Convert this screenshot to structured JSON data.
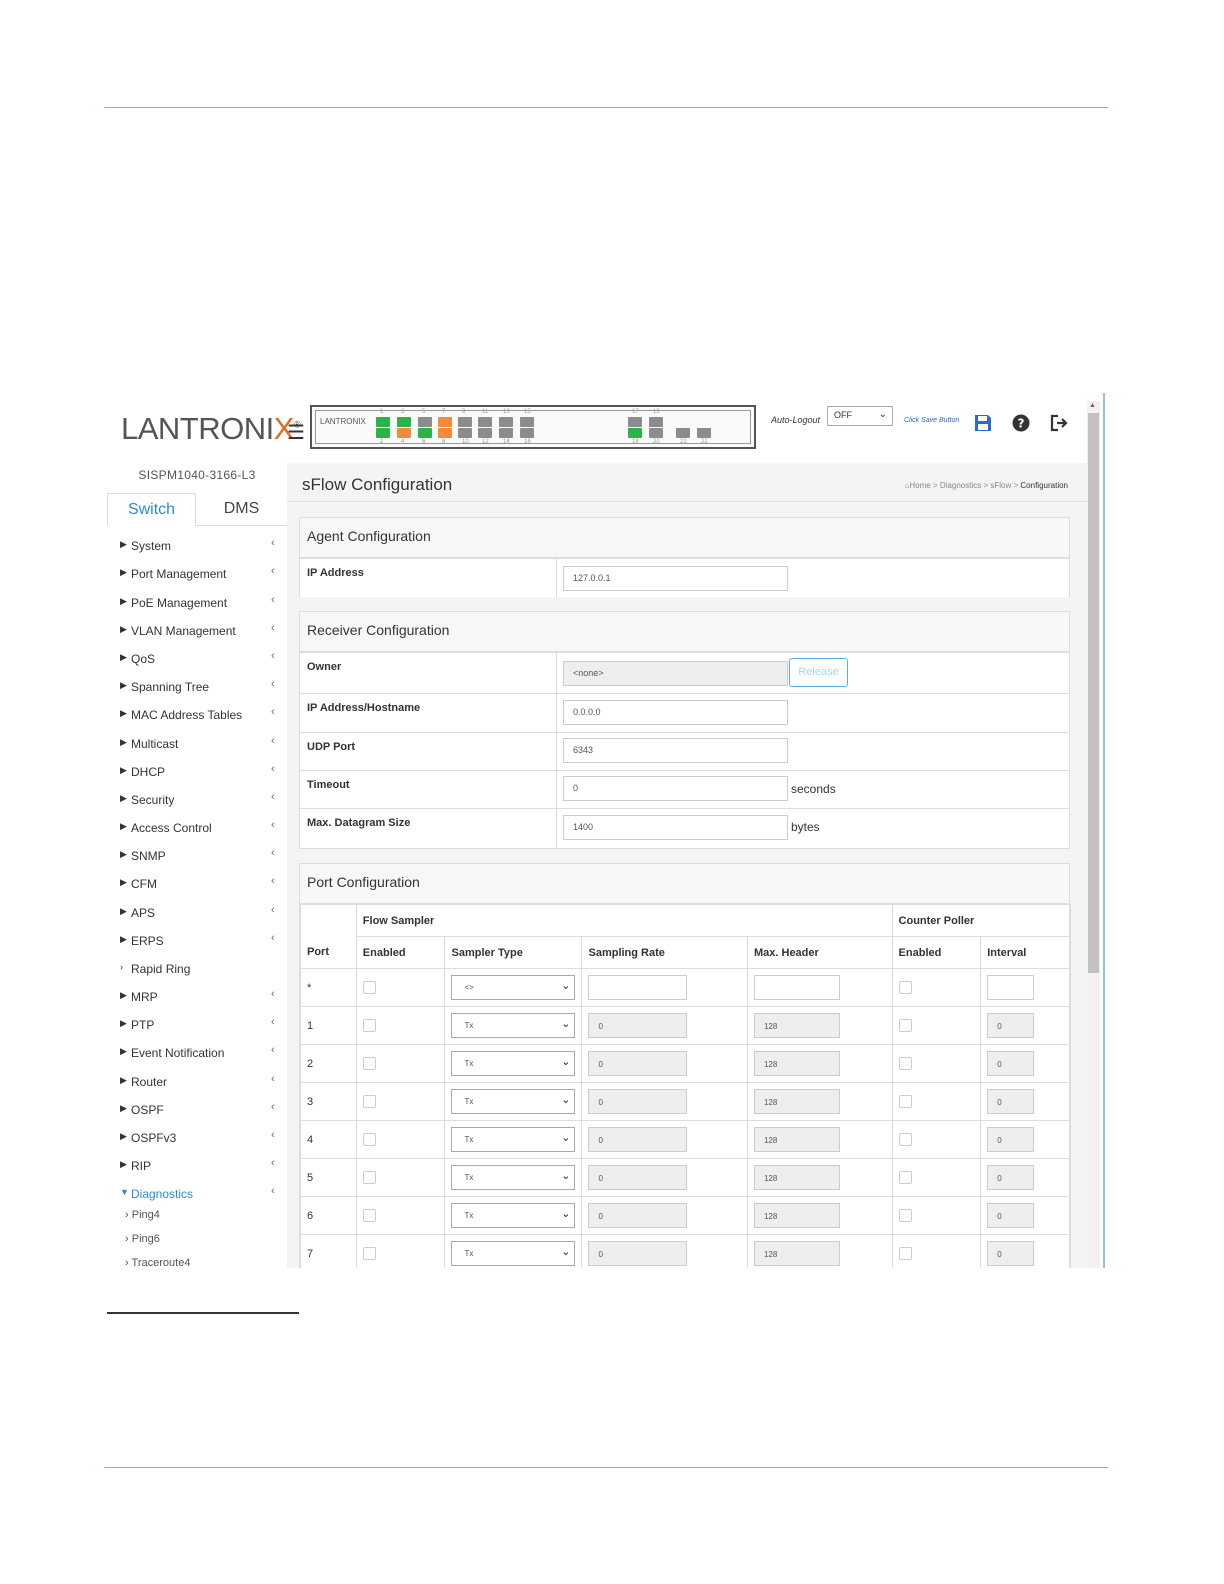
{
  "header": {
    "logo_text": "LANTRONIX",
    "panel_logo": "LANTRONIX",
    "auto_logout_label": "Auto-Logout",
    "auto_logout_value": "OFF",
    "save_hint": "Click Save Button",
    "port_numbers_top": [
      "1",
      "3",
      "5",
      "7",
      "9",
      "11",
      "13",
      "15",
      "17",
      "19"
    ],
    "port_numbers_bottom": [
      "2",
      "4",
      "6",
      "8",
      "10",
      "12",
      "14",
      "16",
      "18",
      "20",
      "21",
      "22"
    ]
  },
  "sidebar": {
    "device_name": "SISPM1040-3166-L3",
    "tabs": [
      "Switch",
      "DMS"
    ],
    "items": [
      "System",
      "Port Management",
      "PoE Management",
      "VLAN Management",
      "QoS",
      "Spanning Tree",
      "MAC Address Tables",
      "Multicast",
      "DHCP",
      "Security",
      "Access Control",
      "SNMP",
      "CFM",
      "APS",
      "ERPS",
      "Rapid Ring",
      "MRP",
      "PTP",
      "Event Notification",
      "Router",
      "OSPF",
      "OSPFv3",
      "RIP",
      "Diagnostics"
    ],
    "sub_items": [
      "Ping4",
      "Ping6",
      "Traceroute4"
    ]
  },
  "content": {
    "title": "sFlow Configuration",
    "breadcrumb": {
      "home": "Home",
      "sep": ">",
      "b1": "Diagnostics",
      "b2": "sFlow",
      "b3": "Configuration"
    },
    "agent": {
      "heading": "Agent Configuration",
      "ip_label": "IP Address",
      "ip_value": "127.0.0.1"
    },
    "receiver": {
      "heading": "Receiver Configuration",
      "owner_label": "Owner",
      "owner_value": "<none>",
      "release_label": "Release",
      "host_label": "IP Address/Hostname",
      "host_value": "0.0.0.0",
      "udp_label": "UDP Port",
      "udp_value": "6343",
      "timeout_label": "Timeout",
      "timeout_value": "0",
      "timeout_unit": "seconds",
      "dgram_label": "Max. Datagram Size",
      "dgram_value": "1400",
      "dgram_unit": "bytes"
    },
    "ports": {
      "heading": "Port Configuration",
      "group_flow": "Flow Sampler",
      "group_counter": "Counter Poller",
      "col_port": "Port",
      "col_enabled": "Enabled",
      "col_type": "Sampler Type",
      "col_rate": "Sampling Rate",
      "col_header": "Max. Header",
      "col_c_enabled": "Enabled",
      "col_interval": "Interval",
      "wild": {
        "port": "*",
        "type": "<>"
      },
      "rows": [
        {
          "port": "1",
          "type": "Tx",
          "rate": "0",
          "header": "128",
          "interval": "0"
        },
        {
          "port": "2",
          "type": "Tx",
          "rate": "0",
          "header": "128",
          "interval": "0"
        },
        {
          "port": "3",
          "type": "Tx",
          "rate": "0",
          "header": "128",
          "interval": "0"
        },
        {
          "port": "4",
          "type": "Tx",
          "rate": "0",
          "header": "128",
          "interval": "0"
        },
        {
          "port": "5",
          "type": "Tx",
          "rate": "0",
          "header": "128",
          "interval": "0"
        },
        {
          "port": "6",
          "type": "Tx",
          "rate": "0",
          "header": "128",
          "interval": "0"
        },
        {
          "port": "7",
          "type": "Tx",
          "rate": "0",
          "header": "128",
          "interval": "0"
        }
      ]
    }
  },
  "colors": {
    "accent": "#2a8cd0",
    "logo_x": "#e46c1e",
    "rule": "#c8a070",
    "port_green": "#2bb24c",
    "port_orange": "#f08a3c",
    "port_gray": "#8c8c8c"
  }
}
